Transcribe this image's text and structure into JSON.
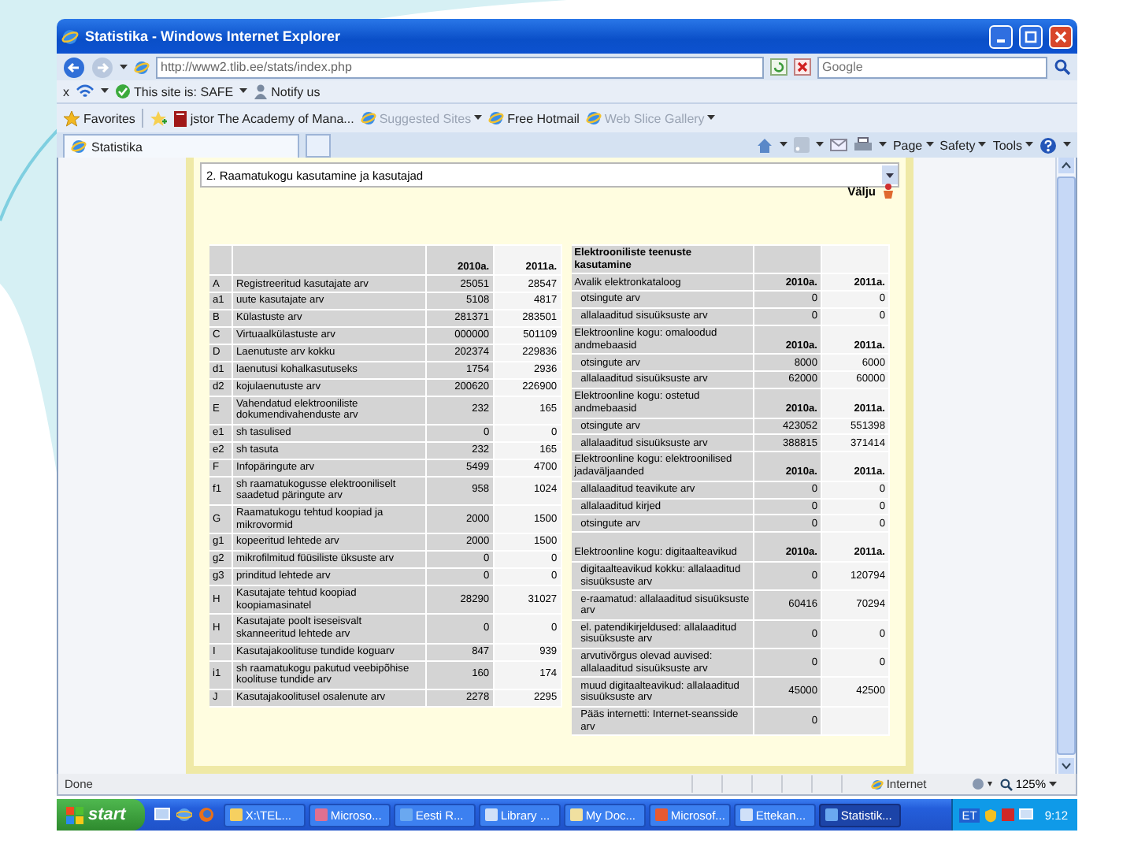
{
  "window": {
    "title": "Statistika - Windows Internet Explorer"
  },
  "address_bar": {
    "url": "http://www2.tlib.ee/stats/index.php"
  },
  "search": {
    "placeholder": "Google"
  },
  "links_toolbar": {
    "close": "x",
    "site_status": "This site is: SAFE",
    "notify": "Notify us"
  },
  "favorites_bar": {
    "favorites": "Favorites",
    "items": [
      {
        "label": "jstor The Academy of Mana...",
        "kind": "book",
        "menu": false,
        "disabled": false
      },
      {
        "label": "Suggested Sites",
        "kind": "globe",
        "menu": true,
        "disabled": true
      },
      {
        "label": "Free Hotmail",
        "kind": "globe",
        "menu": false,
        "disabled": false
      },
      {
        "label": "Web Slice Gallery",
        "kind": "globe",
        "menu": true,
        "disabled": true
      }
    ]
  },
  "tabs": [
    {
      "label": "Statistika",
      "selected": true
    }
  ],
  "command_bar": [
    "Page",
    "Safety",
    "Tools"
  ],
  "page": {
    "report_select": "2. Raamatukogu kasutamine ja kasutajad",
    "exit": "Välju"
  },
  "library_table": {
    "columns": [
      "2010a.",
      "2011a."
    ],
    "rows": [
      {
        "code": "A",
        "label": "Registreeritud kasutajate arv",
        "v2010": "25051",
        "v2011": "28547"
      },
      {
        "code": "a1",
        "label": "uute kasutajate arv",
        "v2010": "5108",
        "v2011": "4817"
      },
      {
        "code": "B",
        "label": "Külastuste arv",
        "v2010": "281371",
        "v2011": "283501"
      },
      {
        "code": "C",
        "label": "Virtuaalkülastuste arv",
        "v2010": "000000",
        "v2011": "501109"
      },
      {
        "code": "D",
        "label": "Laenutuste arv kokku",
        "v2010": "202374",
        "v2011": "229836"
      },
      {
        "code": "d1",
        "label": "laenutusi kohalkasutuseks",
        "v2010": "1754",
        "v2011": "2936"
      },
      {
        "code": "d2",
        "label": "kojulaenutuste arv",
        "v2010": "200620",
        "v2011": "226900"
      },
      {
        "code": "E",
        "label": "Vahendatud elektrooniliste dokumendivahenduste arv",
        "v2010": "232",
        "v2011": "165"
      },
      {
        "code": "e1",
        "label": "sh tasulised",
        "v2010": "0",
        "v2011": "0"
      },
      {
        "code": "e2",
        "label": "sh tasuta",
        "v2010": "232",
        "v2011": "165"
      },
      {
        "code": "F",
        "label": "Infopäringute arv",
        "v2010": "5499",
        "v2011": "4700"
      },
      {
        "code": "f1",
        "label": "sh raamatukogusse elektrooniliselt saadetud päringute arv",
        "v2010": "958",
        "v2011": "1024"
      },
      {
        "code": "G",
        "label": "Raamatukogu tehtud koopiad ja mikrovormid",
        "v2010": "2000",
        "v2011": "1500"
      },
      {
        "code": "g1",
        "label": "kopeeritud lehtede arv",
        "v2010": "2000",
        "v2011": "1500"
      },
      {
        "code": "g2",
        "label": "mikrofilmitud füüsiliste üksuste arv",
        "v2010": "0",
        "v2011": "0"
      },
      {
        "code": "g3",
        "label": "prinditud lehtede arv",
        "v2010": "0",
        "v2011": "0"
      },
      {
        "code": "H",
        "label": "Kasutajate tehtud koopiad koopiamasinatel",
        "v2010": "28290",
        "v2011": "31027"
      },
      {
        "code": "H",
        "label": "Kasutajate poolt iseseisvalt skanneeritud lehtede arv",
        "v2010": "0",
        "v2011": "0"
      },
      {
        "code": "I",
        "label": "Kasutajakoolituse tundide koguarv",
        "v2010": "847",
        "v2011": "939"
      },
      {
        "code": "i1",
        "label": "sh raamatukogu pakutud veebipõhise koolituse tundide arv",
        "v2010": "160",
        "v2011": "174"
      },
      {
        "code": "J",
        "label": "Kasutajakoolitusel osalenute arv",
        "v2010": "2278",
        "v2011": "2295"
      }
    ]
  },
  "eservices_table": {
    "title": "Elektrooniliste teenuste kasutamine",
    "rows": [
      {
        "kind": "header",
        "label": "Avalik elektronkataloog",
        "v2010": "2010a.",
        "v2011": "2011a."
      },
      {
        "kind": "item",
        "label": "otsingute arv",
        "v2010": "0",
        "v2011": "0"
      },
      {
        "kind": "item",
        "label": "allalaaditud sisuüksuste arv",
        "v2010": "0",
        "v2011": "0"
      },
      {
        "kind": "header",
        "label": "Elektroonline kogu: omaloodud andmebaasid",
        "v2010": "2010a.",
        "v2011": "2011a."
      },
      {
        "kind": "item",
        "label": "otsingute arv",
        "v2010": "8000",
        "v2011": "6000"
      },
      {
        "kind": "item",
        "label": "allalaaditud sisuüksuste arv",
        "v2010": "62000",
        "v2011": "60000"
      },
      {
        "kind": "header",
        "label": "Elektroonline kogu: ostetud andmebaasid",
        "v2010": "2010a.",
        "v2011": "2011a."
      },
      {
        "kind": "item",
        "label": "otsingute arv",
        "v2010": "423052",
        "v2011": "551398"
      },
      {
        "kind": "item",
        "label": "allalaaditud sisuüksuste arv",
        "v2010": "388815",
        "v2011": "371414"
      },
      {
        "kind": "header",
        "label": "Elektroonline kogu: elektroonilised jadaväljaanded",
        "v2010": "2010a.",
        "v2011": "2011a."
      },
      {
        "kind": "item",
        "label": "allalaaditud teavikute arv",
        "v2010": "0",
        "v2011": "0"
      },
      {
        "kind": "item",
        "label": "allalaaditud kirjed",
        "v2010": "0",
        "v2011": "0"
      },
      {
        "kind": "item",
        "label": "otsingute arv",
        "v2010": "0",
        "v2011": "0"
      },
      {
        "kind": "spaced_header",
        "label": "Elektroonline kogu: digitaalteavikud",
        "v2010": "2010a.",
        "v2011": "2011a."
      },
      {
        "kind": "item",
        "label": "digitaalteavikud kokku: allalaaditud sisuüksuste arv",
        "v2010": "0",
        "v2011": "120794"
      },
      {
        "kind": "item",
        "label": "e-raamatud: allalaaditud sisuüksuste arv",
        "v2010": "60416",
        "v2011": "70294"
      },
      {
        "kind": "item",
        "label": "el. patendikirjeldused: allalaaditud sisuüksuste arv",
        "v2010": "0",
        "v2011": "0"
      },
      {
        "kind": "item",
        "label": "arvutivõrgus olevad auvised: allalaaditud sisuüksuste arv",
        "v2010": "0",
        "v2011": "0"
      },
      {
        "kind": "item",
        "label": "muud digitaalteavikud: allalaaditud sisuüksuste arv",
        "v2010": "45000",
        "v2011": "42500"
      },
      {
        "kind": "item",
        "label": "Pääs internetti: Internet-seansside arv",
        "v2010": "0"
      }
    ]
  },
  "status_bar": {
    "text": "Done",
    "zone": "Internet",
    "zoom": "125%"
  },
  "taskbar": {
    "start": "start",
    "tasks": [
      {
        "label": "X:\\TEL...",
        "selected": false
      },
      {
        "label": "Microso...",
        "selected": false
      },
      {
        "label": "Eesti R...",
        "selected": false
      },
      {
        "label": "Library ...",
        "selected": false
      },
      {
        "label": "My Doc...",
        "selected": false
      },
      {
        "label": "Microsof...",
        "selected": false
      },
      {
        "label": "Ettekan...",
        "selected": false
      },
      {
        "label": "Statistik...",
        "selected": true
      }
    ],
    "tray": {
      "language": "ET",
      "time": "9:12"
    }
  }
}
